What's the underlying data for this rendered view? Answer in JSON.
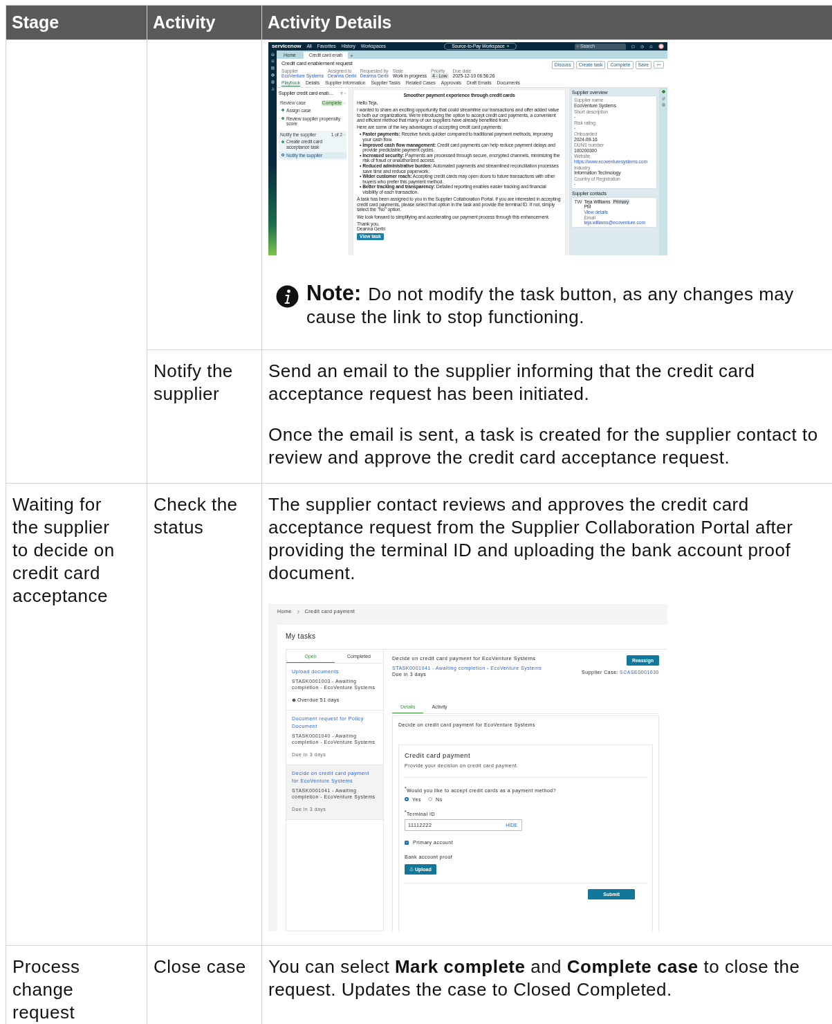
{
  "table": {
    "columns": [
      "Stage",
      "Activity",
      "Activity Details"
    ],
    "stages": [
      {
        "activities": [
          {
            "details": [
              {
                "kind": "case_screenshot",
                "app": {
                  "logo": "servicenow",
                  "nav": [
                    "All",
                    "Favorites",
                    "History",
                    "Workspaces"
                  ],
                  "workspace": "Source-to-Pay Workspace",
                  "search_placeholder": "Search",
                  "tabs": [
                    {
                      "label": "Home",
                      "selected": false
                    },
                    {
                      "label": "Credit card enab",
                      "selected": true
                    }
                  ],
                  "title": "Credit card enablement request",
                  "fields": [
                    {
                      "label": "Supplier",
                      "value": "EcoVenture Systems",
                      "kind": "link"
                    },
                    {
                      "label": "Assigned to",
                      "value": "Deanna Gerbi",
                      "kind": "link"
                    },
                    {
                      "label": "Requested by",
                      "value": "Deanna Gerbi",
                      "kind": "link"
                    },
                    {
                      "label": "State",
                      "value": "Work in progress",
                      "kind": "text"
                    },
                    {
                      "label": "Priority",
                      "value": "4 - Low",
                      "kind": "badge"
                    },
                    {
                      "label": "Due date",
                      "value": "2025-12-10 06:56:26",
                      "kind": "text"
                    }
                  ],
                  "actions": [
                    "Discuss",
                    "Create task",
                    "Complete",
                    "Save"
                  ],
                  "record_tabs": [
                    {
                      "label": "Playbook",
                      "selected": true
                    },
                    {
                      "label": "Details",
                      "selected": false
                    },
                    {
                      "label": "Supplier Information",
                      "selected": false
                    },
                    {
                      "label": "Supplier Tasks",
                      "selected": false
                    },
                    {
                      "label": "Related Cases",
                      "selected": false
                    },
                    {
                      "label": "Approvals",
                      "selected": false
                    },
                    {
                      "label": "Draft Emails",
                      "selected": false
                    },
                    {
                      "label": "Documents",
                      "selected": false
                    }
                  ],
                  "playbook": {
                    "title": "Supplier credit card enab…",
                    "groups": [
                      {
                        "name": "Review case",
                        "badge": "Complete",
                        "current": false,
                        "steps": [
                          {
                            "name": "Assign case",
                            "done": true,
                            "selected": false
                          },
                          {
                            "name": "Review supplier propensity score",
                            "done": true,
                            "selected": false
                          }
                        ]
                      },
                      {
                        "name": "Notify the supplier",
                        "count": "1 of 2",
                        "current": true,
                        "steps": [
                          {
                            "name": "Create credit card acceptance task",
                            "done": true,
                            "selected": false
                          },
                          {
                            "name": "Notify the supplier",
                            "done": false,
                            "selected": true
                          }
                        ]
                      }
                    ]
                  },
                  "email": {
                    "heading": "Smoother payment experience through credit cards",
                    "greeting": "Hello Teja,",
                    "intro": [
                      "I wanted to share an exciting opportunity that could streamline our transactions and offer added value to both our organizations. We're introducing the option to accept credit card payments, a convenient and efficient method that many of our suppliers have already benefited from.",
                      "Here are some of the key advantages of accepting credit card payments:"
                    ],
                    "bullet": "•",
                    "bullets": [
                      "**Faster payments:** Receive funds quicker compared to traditional payment methods, improving your cash flow.",
                      "**Improved cash flow management:** Credit card payments can help reduce payment delays and provide predictable payment cycles.",
                      "**Increased security:** Payments are processed through secure, encrypted channels, minimizing the risk of fraud or unauthorized access.",
                      "**Reduced administrative burden:** Automated payments and streamlined reconciliation processes save time and reduce paperwork.",
                      "**Wider customer reach:** Accepting credit cards may open doors to future transactions with other buyers who prefer this payment method.",
                      "**Better tracking and transparency:** Detailed reporting enables easier tracking and financial visibility of each transaction."
                    ],
                    "outro": [
                      "A task has been assigned to you in the Supplier Collaboration Portal. If you are interested in accepting credit card payments, please select that option in the task and provide the terminal ID. If not, simply select the \"No\" option.",
                      "We look forward to simplifying and accelerating our payment process through this enhancement."
                    ],
                    "signoff": "Thank you,",
                    "signature": "Deanna Gerbi",
                    "button": "View task"
                  },
                  "overview": {
                    "title": "Supplier overview",
                    "fields": [
                      {
                        "label": "Supplier name",
                        "value": "EcoVenture Systems",
                        "kind": "text"
                      },
                      {
                        "label": "Short description",
                        "value": "-",
                        "kind": "text"
                      },
                      {
                        "label": "Risk rating",
                        "value": "-",
                        "kind": "text"
                      },
                      {
                        "label": "Onboarded",
                        "value": "2024-09-16",
                        "kind": "text"
                      },
                      {
                        "label": "DUNS number",
                        "value": "100200300",
                        "kind": "text"
                      },
                      {
                        "label": "Website",
                        "value": "https://www.ecoventuresystems.com",
                        "kind": "link"
                      },
                      {
                        "label": "Industry",
                        "value": "Information Technology",
                        "kind": "text"
                      },
                      {
                        "label": "Country of Registration",
                        "value": "-",
                        "kind": "text"
                      }
                    ]
                  },
                  "contacts": {
                    "title": "Supplier contacts",
                    "initials": "TW",
                    "name": "Teja Williams",
                    "badge": "Primary",
                    "role": "PM",
                    "link": "View details",
                    "email_label": "Email",
                    "email": "teja.williams@ecoventure.com"
                  }
                }
              },
              {
                "kind": "note",
                "label": "Note:",
                "text": "Do not modify the task button, as any changes may cause the link to stop functioning."
              }
            ]
          },
          {
            "name": "Notify the supplier",
            "details": [
              {
                "kind": "paragraph",
                "text": "Send an email to the supplier informing that the credit card acceptance request has been initiated."
              },
              {
                "kind": "paragraph",
                "text": "Once the email is sent, a task is created for the supplier contact to review and approve the credit card acceptance request."
              }
            ]
          }
        ]
      },
      {
        "name": "Waiting for the supplier to decide on credit card acceptance",
        "activities": [
          {
            "name": "Check the status",
            "details": [
              {
                "kind": "paragraph",
                "text": "The supplier contact reviews and approves the credit card acceptance request from the Supplier Collaboration Portal after providing the terminal ID and uploading the bank account proof document."
              },
              {
                "kind": "portal_screenshot",
                "app": {
                  "breadcrumb": [
                    "Home",
                    "Credit card payment"
                  ],
                  "title": "My tasks",
                  "list_tabs": [
                    {
                      "label": "Open",
                      "selected": true
                    },
                    {
                      "label": "Completed",
                      "selected": false
                    }
                  ],
                  "tasks": [
                    {
                      "title": "Upload documents",
                      "meta": "STASK0001003 - Awaiting completion - EcoVenture Systems",
                      "due": "Overdue 51 days",
                      "overdue": true,
                      "selected": false
                    },
                    {
                      "title": "Document request for Policy Document",
                      "meta": "STASK0001040 - Awaiting completion - EcoVenture Systems",
                      "due": "Due in 3 days",
                      "overdue": false,
                      "selected": false
                    },
                    {
                      "title": "Decide on credit card payment for EcoVenture Systems",
                      "meta": "STASK0001041 - Awaiting completion - EcoVenture Systems",
                      "due": "Due in 3 days",
                      "overdue": false,
                      "selected": true
                    }
                  ],
                  "detail": {
                    "title": "Decide on credit card payment for EcoVenture Systems",
                    "meta": "STASK0001041 - Awaiting completion - EcoVenture Systems",
                    "due": "Due in 3 days",
                    "button": "Reassign",
                    "case_label": "Supplier Case:",
                    "case_number": "SCASE0001030",
                    "tabs": [
                      {
                        "label": "Details",
                        "selected": true
                      },
                      {
                        "label": "Activity",
                        "selected": false
                      }
                    ],
                    "description": "Decide on credit card payment for EcoVenture Systems",
                    "form": {
                      "title": "Credit card payment",
                      "subtitle": "Provide your decision on credit card payment.",
                      "question": "$^{*}$Would you like to accept credit cards as a payment method?",
                      "options": [
                        {
                          "label": "Yes",
                          "selected": true
                        },
                        {
                          "label": "No",
                          "selected": false
                        }
                      ],
                      "terminal_label": "$^{*}$Terminal ID",
                      "terminal_value": "11112222",
                      "terminal_action": "HIDE",
                      "checkbox": {
                        "label": "Primary account",
                        "checked": true
                      },
                      "upload_label": "Bank account proof",
                      "upload_button": "Upload",
                      "submit": "Submit"
                    }
                  }
                }
              }
            ]
          }
        ]
      },
      {
        "name": "Process change request",
        "activities": [
          {
            "name": "Close case",
            "details": [
              {
                "kind": "paragraph",
                "text": "You can select **Mark complete** and **Complete case** to close the request. Updates the case to Closed Completed."
              }
            ]
          }
        ]
      }
    ]
  }
}
